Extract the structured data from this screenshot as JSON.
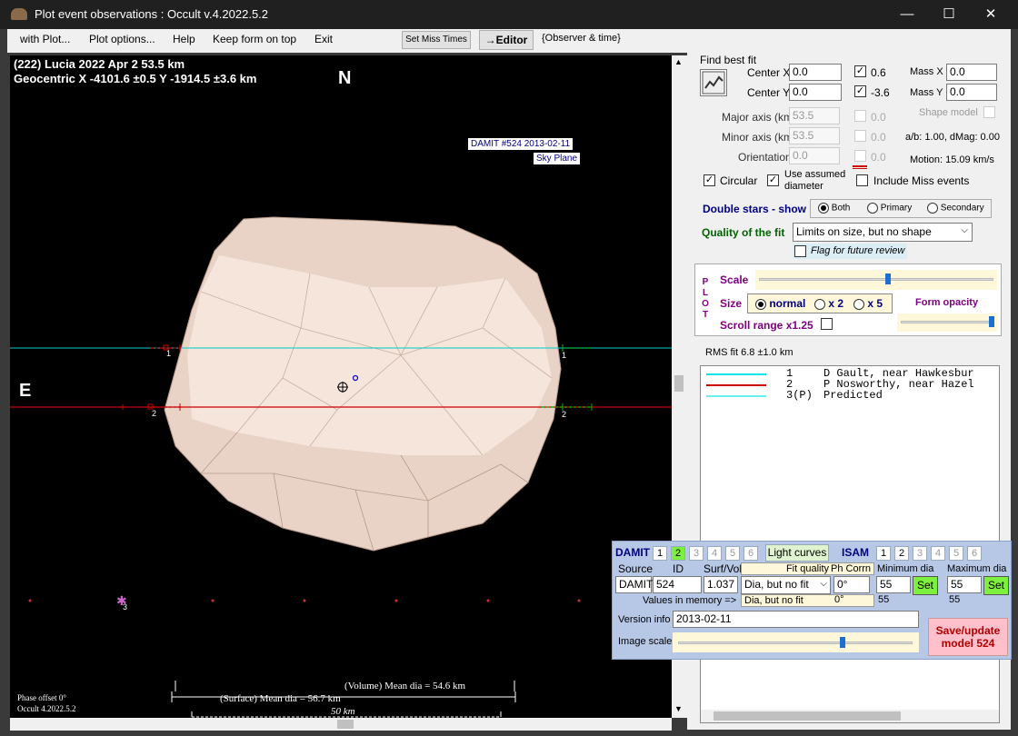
{
  "window": {
    "title": "Plot event observations : Occult v.4.2022.5.2"
  },
  "menu": {
    "items": [
      "with Plot...",
      "Plot options...",
      "Help",
      "Keep form on top",
      "Exit"
    ],
    "set_miss_times": "Set Miss Times",
    "editor": "→Editor",
    "observer_time": "{Observer & time}"
  },
  "plot": {
    "header1": "(222) Lucia  2022 Apr 2   53.5 km",
    "header2": "Geocentric  X  -4101.6 ±0.5  Y -1914.5 ±3.6 km",
    "north": "N",
    "east": "E",
    "damit_label": "DAMIT #524 2013-02-11",
    "sky_plane": "Sky Plane",
    "chord1": "1",
    "chord2": "2",
    "chord3": "3",
    "volume_dia": "(Volume) Mean dia = 54.6 km",
    "surface_dia": "(Surface) Mean dia = 56.7 km",
    "scale_km": "50 km",
    "phase_offset": "Phase offset 0°",
    "version": "Occult 4.2022.5.2"
  },
  "fit": {
    "title": "Find best fit",
    "center_x_label": "Center X",
    "center_x": "0.0",
    "center_y_label": "Center Y",
    "center_y": "0.0",
    "cx_check": "0.6",
    "cy_check": "-3.6",
    "mass_x_label": "Mass X",
    "mass_x": "0.0",
    "mass_y_label": "Mass Y",
    "mass_y": "0.0",
    "major_label": "Major axis (km)",
    "major": "53.5",
    "major_check": "0.0",
    "minor_label": "Minor axis (km)",
    "minor": "53.5",
    "minor_check": "0.0",
    "orient_label": "Orientation",
    "orient": "0.0",
    "orient_check": "0.0",
    "shape_model": "Shape model",
    "ab_dmag": "a/b: 1.00, dMag: 0.00",
    "motion": "Motion: 15.09 km/s",
    "circular": "Circular",
    "use_assumed1": "Use assumed",
    "use_assumed2": "diameter",
    "include_miss": "Include Miss events",
    "double_stars": "Double stars - show",
    "both": "Both",
    "primary": "Primary",
    "secondary": "Secondary",
    "quality_label": "Quality of the fit",
    "quality_value": "Limits on size, but no shape",
    "flag_review": "Flag for future review"
  },
  "plotbox": {
    "side": "PLOT",
    "scale": "Scale",
    "size": "Size",
    "normal": "normal",
    "x2": "x 2",
    "x5": "x 5",
    "form_opacity": "Form opacity",
    "scroll_range": "Scroll range x1.25",
    "scale_fraction": 0.55,
    "opacity_fraction": 0.98
  },
  "rms": "RMS fit 6.8 ±1.0 km",
  "legend": [
    {
      "num": "1",
      "text": "D Gault, near Hawkesbur",
      "color": "#00e5e5"
    },
    {
      "num": "2",
      "text": "P Nosworthy, near Hazel",
      "color": "#cc0000"
    },
    {
      "num": "3(P)",
      "text": "Predicted",
      "color": "#66f0f0"
    }
  ],
  "damit": {
    "label": "DAMIT",
    "tabs": [
      "1",
      "2",
      "3",
      "4",
      "5",
      "6"
    ],
    "active_tab": "2",
    "light_curves": "Light curves",
    "isam": "ISAM",
    "isam_tabs": [
      "1",
      "2",
      "3",
      "4",
      "5",
      "6"
    ],
    "source_h": "Source",
    "id_h": "ID",
    "surf_h": "Surf/Vol",
    "fitq_h": "Fit quality",
    "ph_h": "Ph Corrn",
    "min_h": "Minimum dia",
    "max_h": "Maximum dia",
    "source": "DAMIT",
    "id": "524",
    "surf": "1.037",
    "fitq": "Dia, but no fit",
    "ph": "0°",
    "min": "55",
    "max": "55",
    "values_mem": "Values in memory =>",
    "mem_fitq": "Dia, but no fit",
    "mem_ph": "0°",
    "mem_min": "55",
    "mem_max": "55",
    "set": "Set",
    "version_info": "Version info",
    "version_value": "2013-02-11",
    "image_scale": "Image scale",
    "image_scale_fraction": 0.7,
    "save_update": "Save/update",
    "save_model": "model 524"
  }
}
